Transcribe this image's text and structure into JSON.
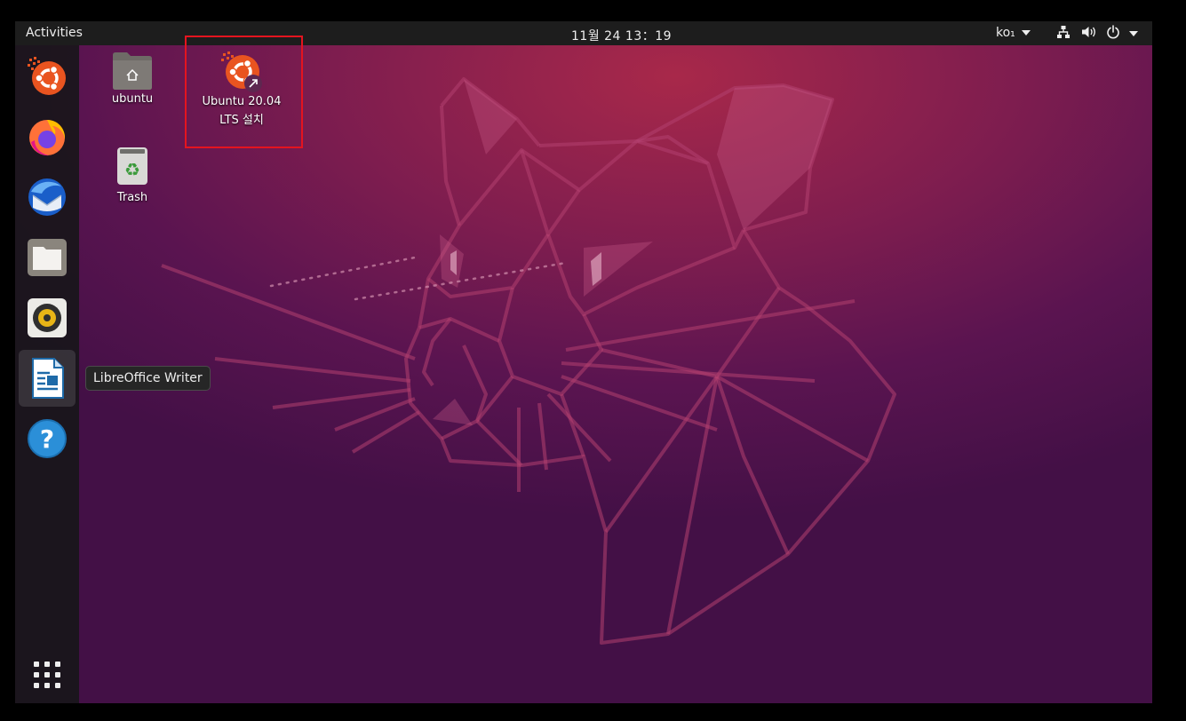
{
  "topbar": {
    "activities_label": "Activities",
    "clock": "11월 24  13：19",
    "input_method": "ko₁",
    "tray_icons": [
      "network-icon",
      "volume-icon",
      "power-icon",
      "chevron-down-icon"
    ]
  },
  "dock": {
    "items": [
      {
        "name": "Ubuntu installer",
        "icon": "ubuntu-installer-icon"
      },
      {
        "name": "Firefox",
        "icon": "firefox-icon"
      },
      {
        "name": "Thunderbird",
        "icon": "thunderbird-icon"
      },
      {
        "name": "Files",
        "icon": "files-icon"
      },
      {
        "name": "Rhythmbox",
        "icon": "rhythmbox-icon"
      },
      {
        "name": "LibreOffice Writer",
        "icon": "libreoffice-writer-icon",
        "active": true
      },
      {
        "name": "Help",
        "icon": "help-icon"
      }
    ],
    "show_apps_icon": "app-grid-icon",
    "tooltip": "LibreOffice Writer"
  },
  "desktop": {
    "icons": [
      {
        "label": "ubuntu",
        "icon": "home-folder-icon"
      },
      {
        "label_line1": "Ubuntu 20.04",
        "label_line2": "LTS 설치",
        "icon": "ubuntu-installer-shortcut-icon",
        "highlighted": true
      },
      {
        "label": "Trash",
        "icon": "trash-icon"
      }
    ]
  },
  "colors": {
    "topbar": "#1d1d1d",
    "ubuntu_orange": "#e95420",
    "highlight_box": "#e4141f",
    "wallpaper_top": "#a8284a",
    "wallpaper_bottom": "#431046"
  }
}
